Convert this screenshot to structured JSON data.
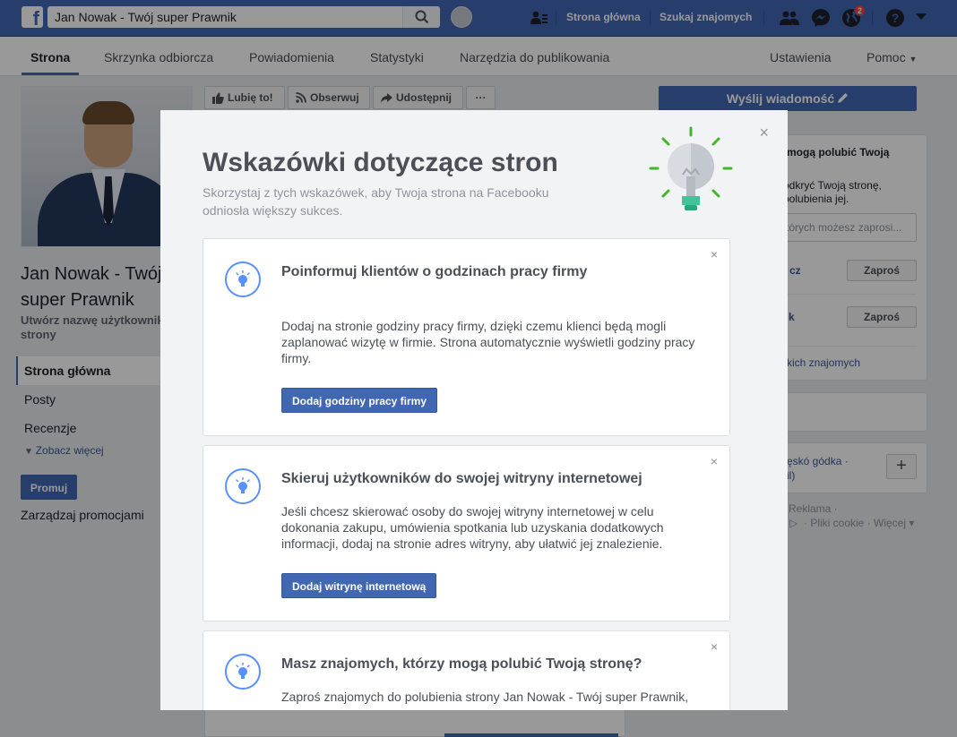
{
  "topbar": {
    "search_value": "Jan Nowak - Twój super Prawnik",
    "home_link": "Strona główna",
    "find_friends_link": "Szukaj znajomych",
    "notification_count": "2"
  },
  "tabs": {
    "page": "Strona",
    "inbox": "Skrzynka odbiorcza",
    "notifications": "Powiadomienia",
    "statistics": "Statystyki",
    "publishing_tools": "Narzędzia do publikowania",
    "settings": "Ustawienia",
    "help": "Pomoc"
  },
  "left": {
    "page_name": "Jan Nowak - Twój super Prawnik",
    "create_username": "Utwórz nazwę użytkownika strony",
    "nav": [
      "Strona główna",
      "Posty",
      "Recenzje"
    ],
    "see_more": "Zobacz więcej",
    "promote_button": "Promuj",
    "manage_promotions": "Zarządzaj promocjami"
  },
  "actions": {
    "like": "Lubię to!",
    "follow": "Obserwuj",
    "share": "Udostępnij",
    "more": "···"
  },
  "right": {
    "send_message": "Wyślij wiadomość",
    "invite_title": "mogą polubić Twoją",
    "invite_desc_1": "odkryć Twoją stronę,",
    "invite_desc_2": "polubienia jej.",
    "friends_placeholder": "tórych możesz zaprosi...",
    "friend_1": "cz",
    "friend_2": "k",
    "invite_button": "Zaproś",
    "see_all_friends": "kich znajomych",
    "sidebar_line_1": "ęskó gódka ·",
    "sidebar_line_2": "il)",
    "footer_1": "Reklama ·",
    "footer_2": "· Pliki cookie · Więcej ▾"
  },
  "modal": {
    "title": "Wskazówki dotyczące stron",
    "subtitle": "Skorzystaj z tych wskazówek, aby Twoja strona na Facebooku odniosła większy sukces.",
    "close": "×",
    "tips": [
      {
        "title": "Poinformuj klientów o godzinach pracy firmy",
        "body": "Dodaj na stronie godziny pracy firmy, dzięki czemu klienci będą mogli zaplanować wizytę w firmie. Strona automatycznie wyświetli godziny pracy firmy.",
        "button": "Dodaj godziny pracy firmy"
      },
      {
        "title": "Skieruj użytkowników do swojej witryny internetowej",
        "body": "Jeśli chcesz skierować osoby do swojej witryny internetowej w celu dokonania zakupu, umówienia spotkania lub uzyskania dodatkowych informacji, dodaj na stronie adres witryny, aby ułatwić jej znalezienie.",
        "button": "Dodaj witrynę internetową"
      },
      {
        "title": "Masz znajomych, którzy mogą polubić Twoją stronę?",
        "body": "Zaproś znajomych do polubienia strony Jan Nowak - Twój super Prawnik,"
      }
    ]
  },
  "colors": {
    "brand_blue": "#4267b2",
    "bulb_green": "#42b72a",
    "tip_icon_blue": "#5890ff"
  },
  "icons": [
    "facebook-logo",
    "search-icon",
    "people-icon",
    "friends-icon",
    "messenger-icon",
    "globe-icon",
    "help-icon",
    "caret-down-icon",
    "like-icon",
    "rss-icon",
    "share-icon",
    "pencil-icon",
    "lightbulb-icon",
    "close-icon",
    "plus-icon"
  ]
}
